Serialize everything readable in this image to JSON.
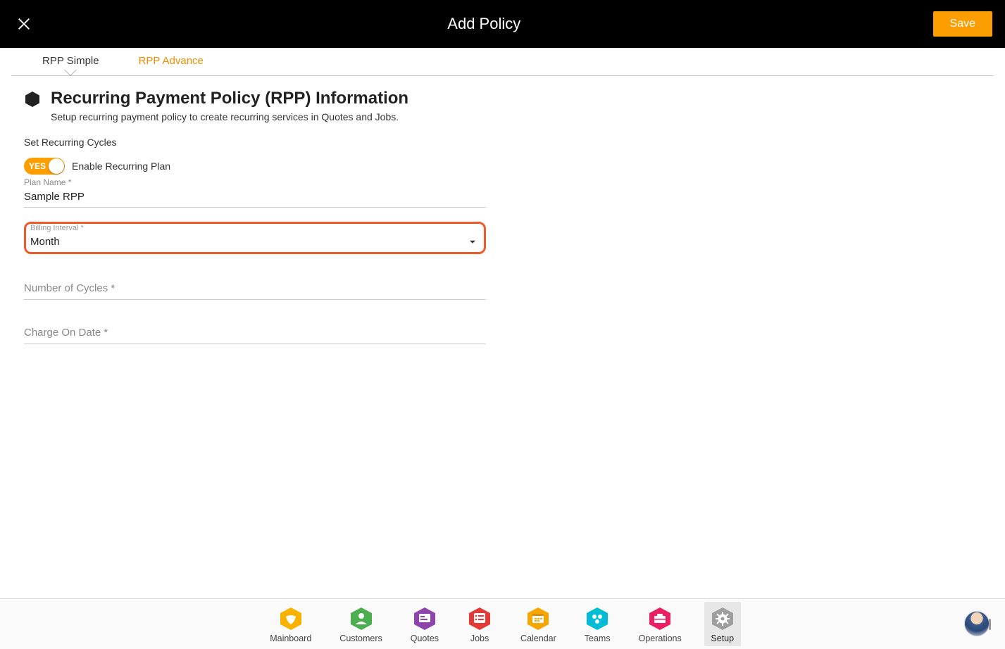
{
  "header": {
    "title": "Add Policy",
    "save_label": "Save"
  },
  "tabs": [
    {
      "label": "RPP Simple",
      "active": true
    },
    {
      "label": "RPP Advance",
      "active": false
    }
  ],
  "section": {
    "title": "Recurring Payment Policy (RPP) Information",
    "subtitle": "Setup recurring payment policy to create recurring services in Quotes and Jobs."
  },
  "form": {
    "set_cycles_label": "Set Recurring Cycles",
    "toggle": {
      "state": "YES",
      "label": "Enable Recurring Plan"
    },
    "plan_name": {
      "label": "Plan Name *",
      "value": "Sample RPP"
    },
    "billing_interval": {
      "label": "Billing Interval *",
      "value": "Month"
    },
    "num_cycles": {
      "label": "Number of Cycles *",
      "value": ""
    },
    "charge_date": {
      "label": "Charge On Date *",
      "value": ""
    }
  },
  "nav": {
    "items": [
      {
        "label": "Mainboard",
        "color": "#f8b300"
      },
      {
        "label": "Customers",
        "color": "#4cae4f"
      },
      {
        "label": "Quotes",
        "color": "#8e44ad"
      },
      {
        "label": "Jobs",
        "color": "#e53935"
      },
      {
        "label": "Calendar",
        "color": "#f6a600"
      },
      {
        "label": "Teams",
        "color": "#00bcd4"
      },
      {
        "label": "Operations",
        "color": "#e91e63"
      },
      {
        "label": "Setup",
        "color": "#9e9e9e"
      }
    ],
    "active": "Setup"
  }
}
